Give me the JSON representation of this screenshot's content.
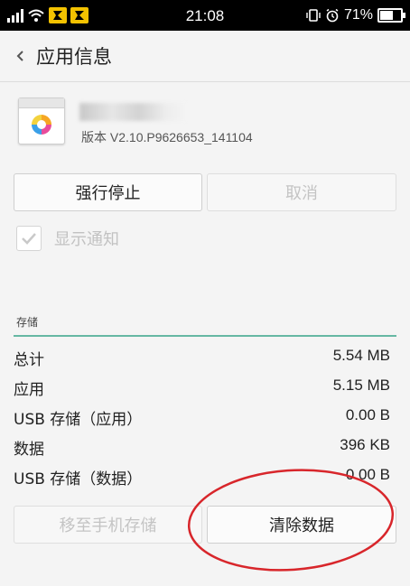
{
  "status_bar": {
    "time": "21:08",
    "battery_text": "71%",
    "battery_level": 0.71
  },
  "header": {
    "title": "应用信息"
  },
  "app": {
    "version": "版本 V2.10.P9626653_141104"
  },
  "actions": {
    "force_stop": "强行停止",
    "cancel": "取消"
  },
  "notification": {
    "label": "显示通知",
    "checked": true
  },
  "storage": {
    "section_title": "存储",
    "rows": [
      {
        "label": "总计",
        "value": "5.54 MB"
      },
      {
        "label": "应用",
        "value": "5.15 MB"
      },
      {
        "label": "USB 存储（应用）",
        "value": "0.00 B"
      },
      {
        "label": "数据",
        "value": "396 KB"
      },
      {
        "label": "USB 存储（数据）",
        "value": "0.00 B"
      }
    ],
    "move_to_phone": "移至手机存储",
    "clear_data": "清除数据"
  },
  "colors": {
    "accent_line": "#66b8a3",
    "annotation": "#d8262b",
    "notify_icon_bg": "#f3c200"
  },
  "icons": [
    "signal-icon",
    "wifi-icon",
    "notification-icon",
    "back-icon",
    "app-icon",
    "check-icon",
    "vibrate-icon",
    "alarm-icon",
    "battery-icon"
  ]
}
